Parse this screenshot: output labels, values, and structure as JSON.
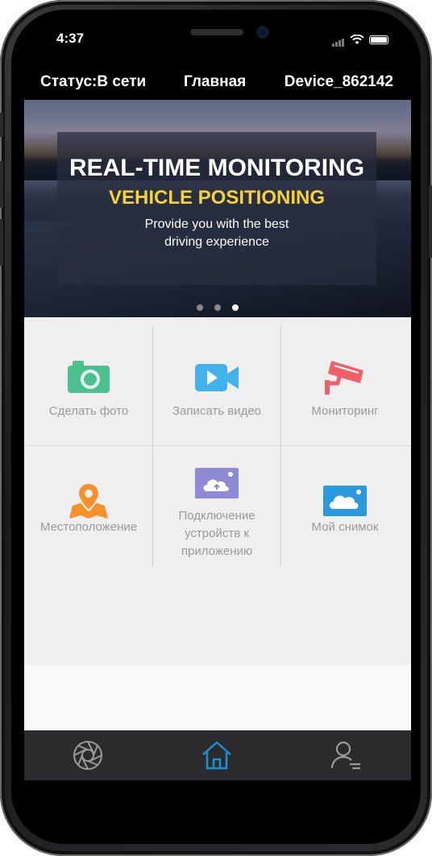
{
  "status_bar": {
    "time": "4:37"
  },
  "header": {
    "status": "Статус:В сети",
    "title": "Главная",
    "device": "Device_862142"
  },
  "banner": {
    "line1": "REAL-TIME MONITORING",
    "line2": "VEHICLE POSITIONING",
    "line3a": "Provide you with the best",
    "line3b": "driving experience",
    "dots": 3,
    "active_dot": 3
  },
  "grid": [
    {
      "label": "Сделать фото",
      "icon": "camera-icon",
      "color": "#4cc08f"
    },
    {
      "label": "Записать видео",
      "icon": "video-camera-icon",
      "color": "#41b3ea"
    },
    {
      "label": "Мониторинг",
      "icon": "cctv-icon",
      "color": "#f0606a"
    },
    {
      "label": "Местоположение",
      "icon": "map-location-icon",
      "color": "#f5902a"
    },
    {
      "label_lines": [
        "Подключение",
        "устройств к",
        "приложению"
      ],
      "icon": "cloud-upload-icon",
      "color": "#8f8ad6"
    },
    {
      "label": "Мой снимок",
      "icon": "cloud-photo-icon",
      "color": "#2a9ae0"
    }
  ],
  "tabbar": {
    "tabs": [
      {
        "icon": "aperture-icon",
        "active": false
      },
      {
        "icon": "home-icon",
        "active": true
      },
      {
        "icon": "user-icon",
        "active": false
      }
    ],
    "active_color": "#1e8fd6",
    "inactive_color": "#9a9a9a"
  }
}
